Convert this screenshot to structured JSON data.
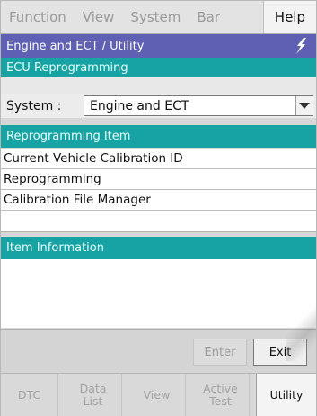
{
  "menu": {
    "items": [
      "Function",
      "View",
      "System",
      "Bar"
    ],
    "help": "Help"
  },
  "title": {
    "text": "Engine and ECT / Utility",
    "icon": "lightning-bolt-icon"
  },
  "sections": {
    "ecu_reprogramming": "ECU Reprogramming",
    "reprogramming_item": "Reprogramming Item",
    "item_information": "Item Information"
  },
  "system": {
    "label": "System :",
    "value": "Engine and ECT"
  },
  "items": [
    "Current Vehicle Calibration ID",
    "Reprogramming",
    "Calibration File Manager"
  ],
  "buttons": {
    "enter": "Enter",
    "exit": "Exit"
  },
  "tabs": {
    "dtc": "DTC",
    "data_list_1": "Data",
    "data_list_2": "List",
    "view": "View",
    "active_test_1": "Active",
    "active_test_2": "Test",
    "utility": "Utility"
  },
  "colors": {
    "title_bar": "#5f5fb3",
    "section_header": "#17a3a3"
  }
}
